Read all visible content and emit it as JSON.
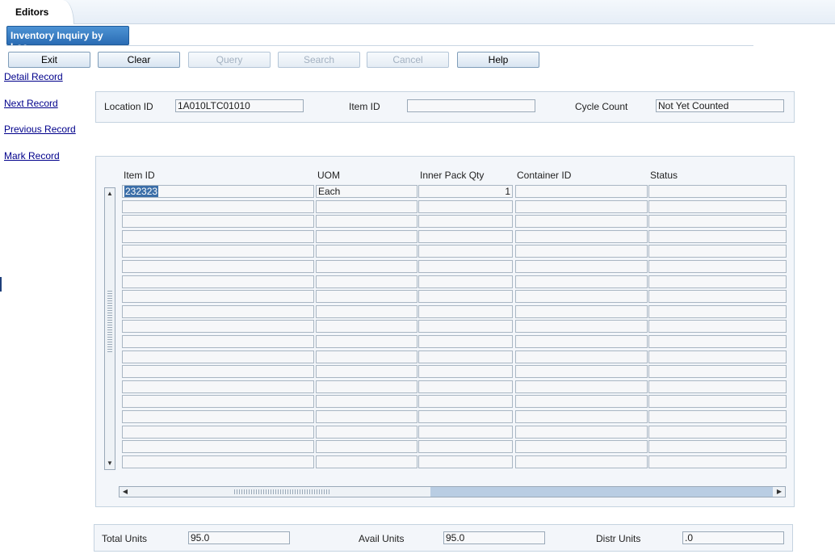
{
  "tabs": {
    "editors": "Editors"
  },
  "form": {
    "title": "Inventory Inquiry by Loc..."
  },
  "toolbar": {
    "buttons": [
      {
        "label": "Exit",
        "enabled": true
      },
      {
        "label": "Clear",
        "enabled": true
      },
      {
        "label": "Query",
        "enabled": false
      },
      {
        "label": "Search",
        "enabled": false
      },
      {
        "label": "Cancel",
        "enabled": false
      },
      {
        "label": "Help",
        "enabled": true
      }
    ]
  },
  "side_links": [
    "Detail Record",
    "Next Record",
    "Previous Record",
    "Mark Record"
  ],
  "header": {
    "location_label": "Location ID",
    "location_value": "1A010LTC01010",
    "item_label": "Item ID",
    "item_value": "",
    "cycle_label": "Cycle Count",
    "cycle_value": "Not Yet Counted"
  },
  "grid": {
    "columns": [
      "Item ID",
      "UOM",
      "Inner Pack Qty",
      "Container ID",
      "Status"
    ],
    "rows": [
      [
        "232323",
        "Each",
        "1",
        "",
        ""
      ],
      [
        "",
        "",
        "",
        "",
        ""
      ],
      [
        "",
        "",
        "",
        "",
        ""
      ],
      [
        "",
        "",
        "",
        "",
        ""
      ],
      [
        "",
        "",
        "",
        "",
        ""
      ],
      [
        "",
        "",
        "",
        "",
        ""
      ],
      [
        "",
        "",
        "",
        "",
        ""
      ],
      [
        "",
        "",
        "",
        "",
        ""
      ],
      [
        "",
        "",
        "",
        "",
        ""
      ],
      [
        "",
        "",
        "",
        "",
        ""
      ],
      [
        "",
        "",
        "",
        "",
        ""
      ],
      [
        "",
        "",
        "",
        "",
        ""
      ],
      [
        "",
        "",
        "",
        "",
        ""
      ],
      [
        "",
        "",
        "",
        "",
        ""
      ],
      [
        "",
        "",
        "",
        "",
        ""
      ],
      [
        "",
        "",
        "",
        "",
        ""
      ],
      [
        "",
        "",
        "",
        "",
        ""
      ],
      [
        "",
        "",
        "",
        "",
        ""
      ],
      [
        "",
        "",
        "",
        "",
        ""
      ]
    ],
    "selected_row": 0
  },
  "totals": {
    "total_label": "Total Units",
    "total_value": "95.0",
    "avail_label": "Avail Units",
    "avail_value": "95.0",
    "distr_label": "Distr Units",
    "distr_value": ".0"
  },
  "icons": {
    "scroll_up": "up-arrow-icon",
    "scroll_down": "down-arrow-icon",
    "scroll_left": "left-arrow-icon",
    "scroll_right": "right-arrow-icon"
  },
  "colors": {
    "accent": "#2a6cb4",
    "link": "#00008b",
    "selection": "#3b6ea8"
  }
}
